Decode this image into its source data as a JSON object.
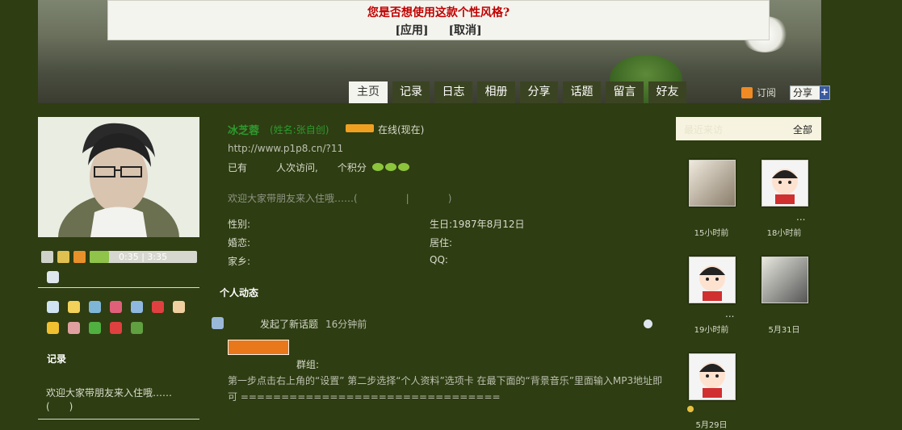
{
  "notice": {
    "title": "您是否想使用这款个性风格?",
    "apply": "[应用]",
    "cancel": "[取消]"
  },
  "tabs": [
    "主页",
    "记录",
    "日志",
    "相册",
    "分享",
    "话题",
    "留言",
    "好友"
  ],
  "top_right": {
    "subscribe": "订阅",
    "share": "分享"
  },
  "profile": {
    "name": "冰芝蓉",
    "real_name": "(姓名:张自创)",
    "status": "在线(现在)",
    "url": "http://www.p1p8.cn/?11",
    "stats": "已有　　　人次访问,　　个积分",
    "greeting": "欢迎大家带朋友来入住哦……(　　　　　|　　　　)",
    "gender_label": "性别:",
    "birthday": "生日:1987年8月12日",
    "marital_label": "婚恋:",
    "residence_label": "居住:",
    "hometown_label": "家乡:",
    "qq_label": "QQ:"
  },
  "player": {
    "time": "0:35 | 3:35",
    "progress": 0.18
  },
  "left": {
    "records_title": "记录",
    "records_text": "欢迎大家带朋友来入住哦……(　　)"
  },
  "feed": {
    "title": "个人动态",
    "action": "发起了新话题",
    "time": "16分钟前",
    "group_label": "群组:",
    "body": "第一步点击右上角的“设置” 第二步选择“个人资料”选项卡 在最下面的“背景音乐”里面输入MP3地址即可 ================================"
  },
  "recent": {
    "title": "最近来访",
    "all": "全部",
    "visitors": [
      {
        "time": "15小时前"
      },
      {
        "time": "18小时前",
        "name": "..."
      },
      {
        "time": "19小时前",
        "name": "..."
      },
      {
        "time": "5月31日"
      },
      {
        "time": "5月29日"
      }
    ]
  }
}
